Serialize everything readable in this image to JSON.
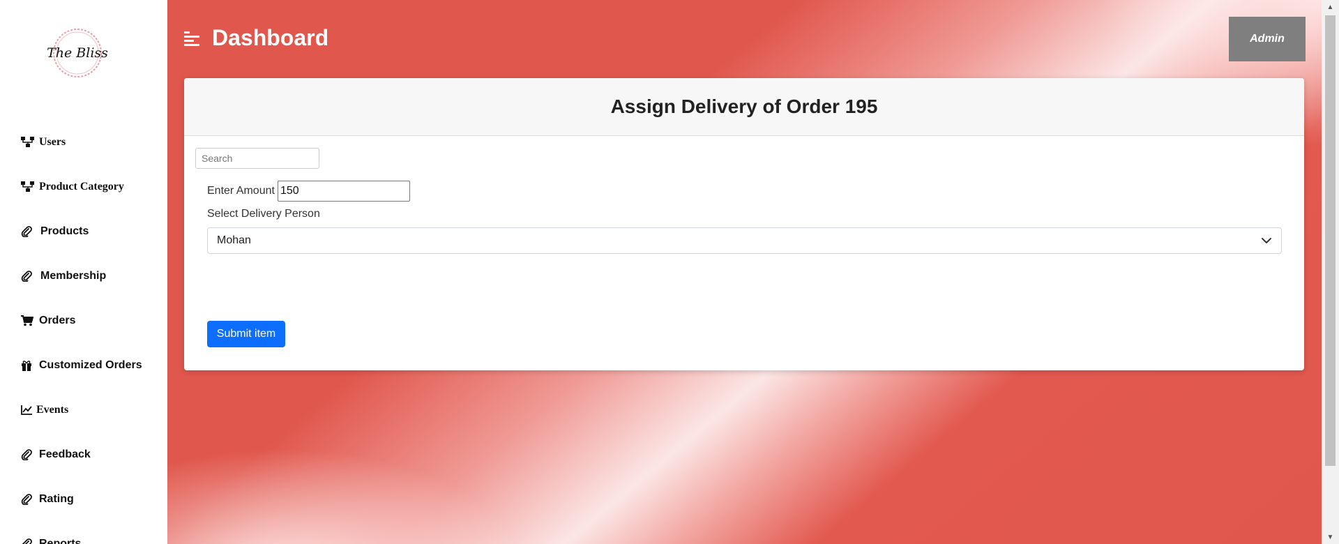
{
  "logo": {
    "text": "The Bliss"
  },
  "sidebar": {
    "items": [
      {
        "label": "Users",
        "icon": "sitemap-icon",
        "serif": true
      },
      {
        "label": "Product Category",
        "icon": "sitemap-icon",
        "serif": true
      },
      {
        "label": "Products",
        "icon": "paperclip-icon",
        "serif": false
      },
      {
        "label": "Membership",
        "icon": "paperclip-icon",
        "serif": false
      },
      {
        "label": "Orders",
        "icon": "cart-icon",
        "serif": false
      },
      {
        "label": "Customized Orders",
        "icon": "gift-icon",
        "serif": false
      },
      {
        "label": "Events",
        "icon": "chart-line-icon",
        "serif": true
      },
      {
        "label": "Feedback",
        "icon": "paperclip-icon",
        "serif": false
      },
      {
        "label": "Rating",
        "icon": "paperclip-icon",
        "serif": false
      },
      {
        "label": "Reports",
        "icon": "paperclip-icon",
        "serif": false
      }
    ]
  },
  "header": {
    "title": "Dashboard",
    "admin_label": "Admin"
  },
  "card": {
    "title": "Assign Delivery of Order 195",
    "search_placeholder": "Search",
    "amount_label": "Enter Amount",
    "amount_value": "150",
    "delivery_label": "Select Delivery Person",
    "delivery_selected": "Mohan",
    "submit_label": "Submit item"
  },
  "colors": {
    "accent": "#e0574d",
    "submit": "#0d6efd",
    "admin": "#7f7f7f"
  }
}
